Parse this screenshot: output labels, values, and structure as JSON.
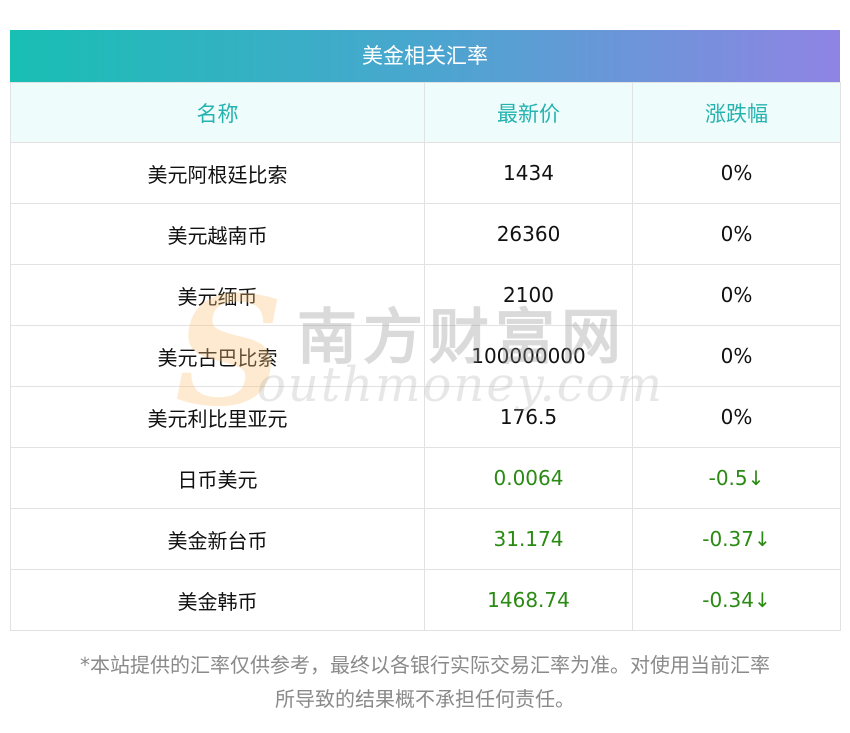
{
  "table": {
    "title": "美金相关汇率",
    "headers": {
      "name": "名称",
      "price": "最新价",
      "change": "涨跌幅"
    },
    "rows": [
      {
        "name": "美元阿根廷比索",
        "price": "1434",
        "change": "0%",
        "negative": false
      },
      {
        "name": "美元越南币",
        "price": "26360",
        "change": "0%",
        "negative": false
      },
      {
        "name": "美元缅币",
        "price": "2100",
        "change": "0%",
        "negative": false
      },
      {
        "name": "美元古巴比索",
        "price": "100000000",
        "change": "0%",
        "negative": false
      },
      {
        "name": "美元利比里亚元",
        "price": "176.5",
        "change": "0%",
        "negative": false
      },
      {
        "name": "日币美元",
        "price": "0.0064",
        "change": "-0.5↓",
        "negative": true
      },
      {
        "name": "美金新台币",
        "price": "31.174",
        "change": "-0.37↓",
        "negative": true
      },
      {
        "name": "美金韩币",
        "price": "1468.74",
        "change": "-0.34↓",
        "negative": true
      }
    ]
  },
  "watermark": {
    "logo_letter": "S",
    "brand_cn": "南方财富网",
    "brand_en": "outhmoney.com"
  },
  "disclaimer": {
    "line1": "*本站提供的汇率仅供参考，最终以各银行实际交易汇率为准。对使用当前汇率",
    "line2": "所导致的结果概不承担任何责任。"
  },
  "colors": {
    "header_text": "#26b3b0",
    "negative": "#2a8a14",
    "title_gradient": [
      "#18bfb3",
      "#8f84e4"
    ]
  }
}
